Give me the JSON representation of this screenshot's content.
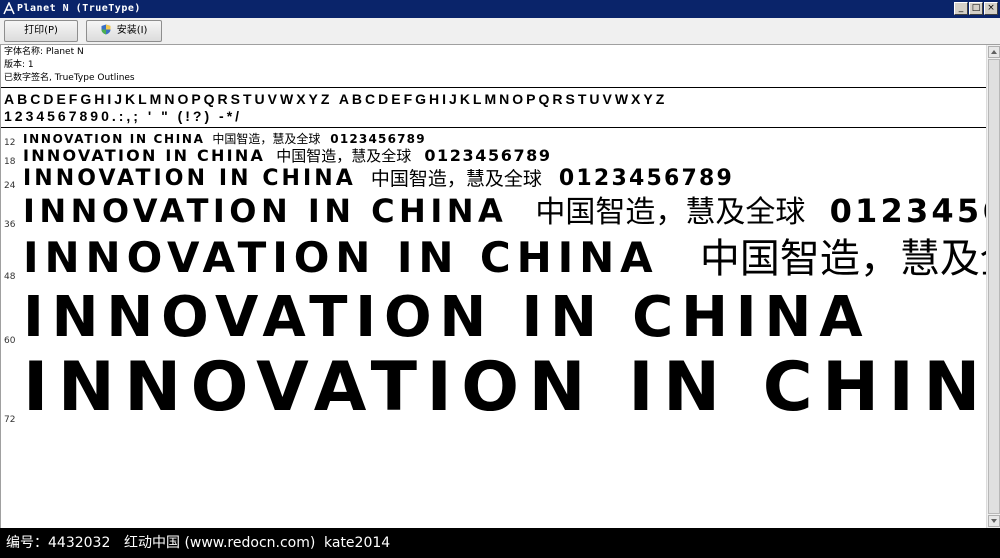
{
  "window": {
    "title": "Planet N (TrueType)"
  },
  "toolbar": {
    "print_label": "打印(P)",
    "install_label": "安装(I)"
  },
  "info": {
    "font_name": "字体名称: Planet N",
    "version": "版本: 1",
    "signature": "已数字签名, TrueType Outlines"
  },
  "charset": {
    "line1": "ABCDEFGHIJKLMNOPQRSTUVWXYZ  ABCDEFGHIJKLMNOPQRSTUVWXYZ",
    "line2": "1234567890.:,;  '  \"  (!?)  -*/"
  },
  "samples": {
    "english": "INNOVATION IN CHINA",
    "chinese": "中国智造，慧及全球",
    "numbers": "0123456789",
    "sizes": [
      "12",
      "18",
      "24",
      "36",
      "48",
      "60",
      "72"
    ]
  },
  "watermark": {
    "id": "编号：4432032",
    "site": "红动中国 (www.redocn.com)",
    "author": "kate2014"
  }
}
